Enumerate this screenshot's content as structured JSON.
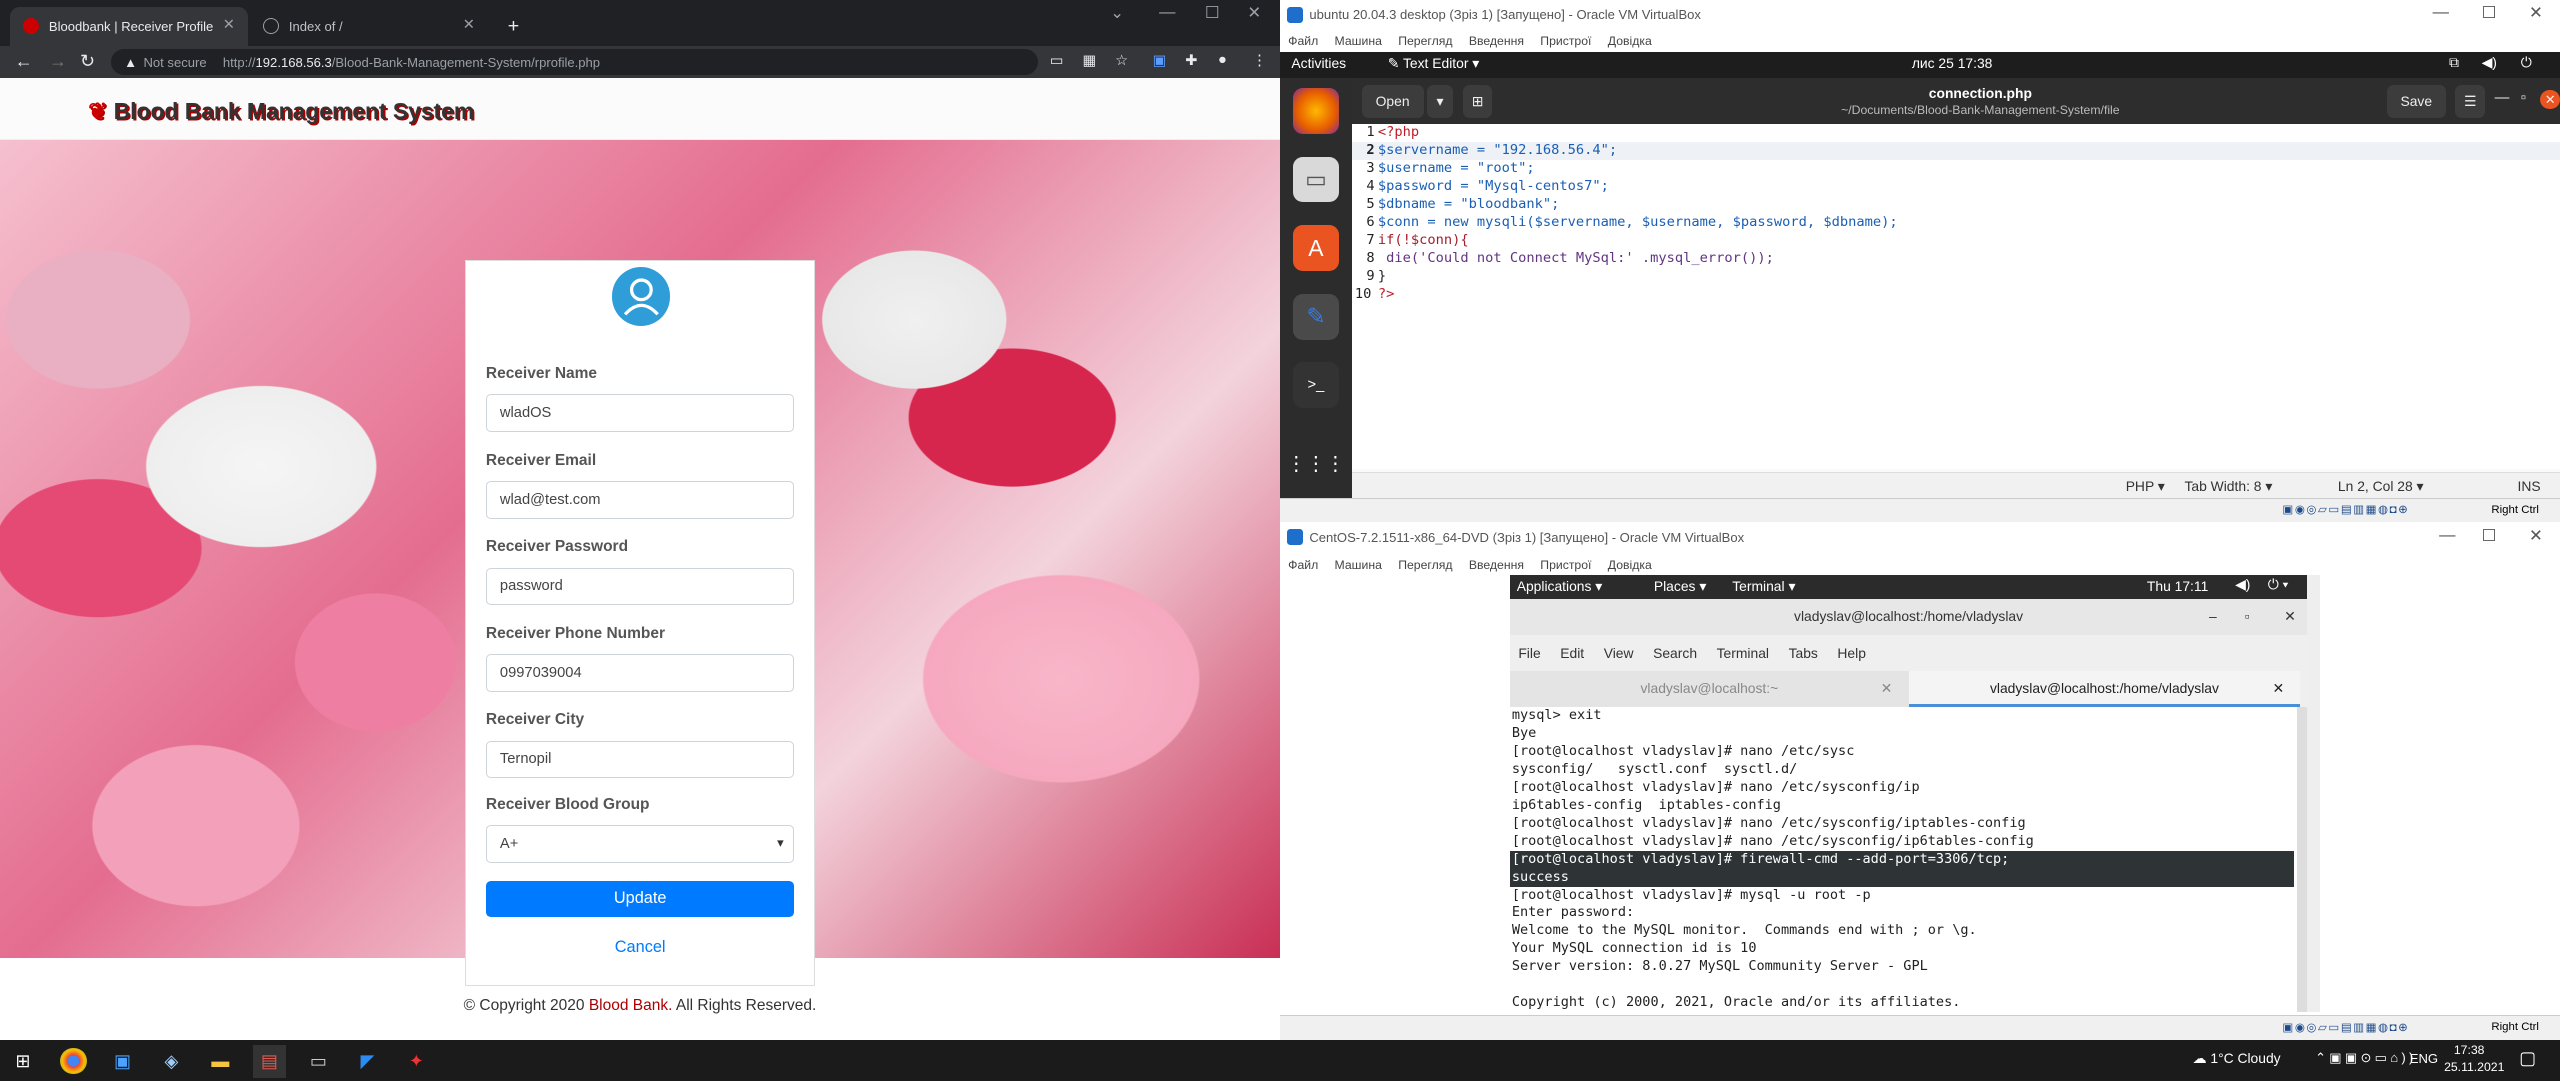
{
  "chrome": {
    "tabs": [
      {
        "title": "Bloodbank | Receiver Profile",
        "active": true
      },
      {
        "title": "Index of /",
        "active": false
      }
    ],
    "url_secure": "Not secure",
    "url_scheme": "http://",
    "url_host": "192.168.56.3",
    "url_path": "/Blood-Bank-Management-System/rprofile.php"
  },
  "site": {
    "brand": "Blood Bank Management System",
    "form": {
      "name_label": "Receiver Name",
      "name_value": "wladOS",
      "email_label": "Receiver Email",
      "email_value": "wlad@test.com",
      "password_label": "Receiver Password",
      "password_value": "password",
      "phone_label": "Receiver Phone Number",
      "phone_value": "0997039004",
      "city_label": "Receiver City",
      "city_value": "Ternopil",
      "blood_label": "Receiver Blood Group",
      "blood_value": "A+",
      "update_label": "Update",
      "cancel_label": "Cancel"
    },
    "footer_prefix": "© Copyright 2020",
    "footer_brand": "Blood Bank.",
    "footer_suffix": "All Rights Reserved."
  },
  "vbox_ubuntu": {
    "title": "ubuntu 20.04.3 desktop (Зріз 1) [Запущено] - Oracle VM VirtualBox",
    "menu": [
      "Файл",
      "Машина",
      "Перегляд",
      "Введення",
      "Пристрої",
      "Довідка"
    ],
    "activities": "Activities",
    "app_menu": "Text Editor",
    "clock": "лис 25  17:38",
    "editor": {
      "open_label": "Open",
      "save_label": "Save",
      "file_name": "connection.php",
      "file_path": "~/Documents/Blood-Bank-Management-System/file",
      "lines": [
        "<?php",
        "$servername = \"192.168.56.4\";",
        "$username = \"root\";",
        "$password = \"Mysql-centos7\";",
        "$dbname = \"bloodbank\";",
        "$conn = new mysqli($servername, $username, $password, $dbname);",
        "if(!$conn){",
        " die('Could not Connect MySql:' .mysql_error());",
        "}",
        "?>"
      ],
      "status_lang": "PHP",
      "status_tab": "Tab Width: 8",
      "status_pos": "Ln 2, Col 28",
      "status_mode": "INS"
    },
    "host_key": "Right Ctrl"
  },
  "vbox_centos": {
    "title": "CentOS-7.2.1511-x86_64-DVD (Зріз 1) [Запущено] - Oracle VM VirtualBox",
    "menu": [
      "Файл",
      "Машина",
      "Перегляд",
      "Введення",
      "Пристрої",
      "Довідка"
    ],
    "gnome": {
      "applications": "Applications",
      "places": "Places",
      "terminal": "Terminal",
      "clock": "Thu 17:11"
    },
    "terminal": {
      "title": "vladyslav@localhost:/home/vladyslav",
      "menu": [
        "File",
        "Edit",
        "View",
        "Search",
        "Terminal",
        "Tabs",
        "Help"
      ],
      "tab1": "vladyslav@localhost:~",
      "tab2": "vladyslav@localhost:/home/vladyslav",
      "lines": [
        "mysql> exit",
        "Bye",
        "[root@localhost vladyslav]# nano /etc/sysc",
        "sysconfig/   sysctl.conf  sysctl.d/",
        "[root@localhost vladyslav]# nano /etc/sysconfig/ip",
        "ip6tables-config  iptables-config",
        "[root@localhost vladyslav]# nano /etc/sysconfig/iptables-config",
        "[root@localhost vladyslav]# nano /etc/sysconfig/ip6tables-config",
        "[root@localhost vladyslav]# firewall-cmd --add-port=3306/tcp;",
        "success",
        "[root@localhost vladyslav]# mysql -u root -p",
        "Enter password:",
        "Welcome to the MySQL monitor.  Commands end with ; or \\g.",
        "Your MySQL connection id is 10",
        "Server version: 8.0.27 MySQL Community Server - GPL",
        "",
        "Copyright (c) 2000, 2021, Oracle and/or its affiliates."
      ]
    },
    "host_key": "Right Ctrl"
  },
  "taskbar": {
    "weather": "1°C  Cloudy",
    "lang": "ENG",
    "time": "17:38",
    "date": "25.11.2021"
  },
  "colors": {
    "bootstrap_primary": "#007bff",
    "brand_red": "#aa0000",
    "ubuntu_orange": "#e95420"
  }
}
